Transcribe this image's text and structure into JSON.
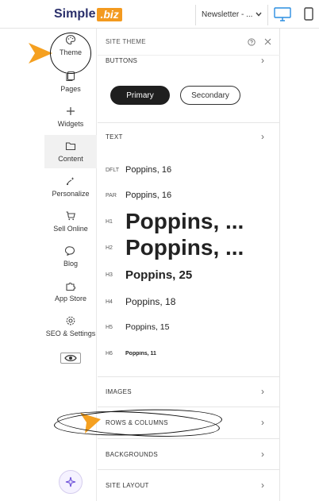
{
  "topbar": {
    "logo_text": "Simple",
    "logo_badge": ".biz",
    "page_selector": "Newsletter - ...",
    "desktop_icon": "monitor-icon",
    "mobile_icon": "phone-icon"
  },
  "rail": {
    "items": [
      {
        "label": "Theme",
        "icon": "palette-icon"
      },
      {
        "label": "Pages",
        "icon": "pages-icon"
      },
      {
        "label": "Widgets",
        "icon": "plus-icon"
      },
      {
        "label": "Content",
        "icon": "folder-icon"
      },
      {
        "label": "Personalize",
        "icon": "personalize-icon"
      },
      {
        "label": "Sell Online",
        "icon": "cart-icon"
      },
      {
        "label": "Blog",
        "icon": "chat-bubble-icon"
      },
      {
        "label": "App Store",
        "icon": "puzzle-icon"
      },
      {
        "label": "SEO & Settings",
        "icon": "gear-icon"
      }
    ],
    "preview_icon": "eye-icon",
    "ai_icon": "sparkle-icon"
  },
  "panel": {
    "title": "SITE THEME",
    "sections": {
      "buttons": "BUTTONS",
      "text": "TEXT",
      "images": "IMAGES",
      "rows_columns": "ROWS & COLUMNS",
      "backgrounds": "BACKGROUNDS",
      "site_layout": "SITE LAYOUT"
    },
    "button_samples": {
      "primary": "Primary",
      "secondary": "Secondary"
    },
    "text_styles": [
      {
        "tag": "DFLT",
        "sample": "Poppins, 16"
      },
      {
        "tag": "PAR",
        "sample": "Poppins, 16"
      },
      {
        "tag": "H1",
        "sample": "Poppins, ..."
      },
      {
        "tag": "H2",
        "sample": "Poppins, ..."
      },
      {
        "tag": "H3",
        "sample": "Poppins, 25"
      },
      {
        "tag": "H4",
        "sample": "Poppins, 18"
      },
      {
        "tag": "H5",
        "sample": "Poppins, 15"
      },
      {
        "tag": "H6",
        "sample": "Poppins, 11"
      }
    ],
    "chevron": "›"
  },
  "colors": {
    "brand_navy": "#2a2f6b",
    "brand_orange": "#f39a1f",
    "annotation_arrow": "#f5a020"
  }
}
